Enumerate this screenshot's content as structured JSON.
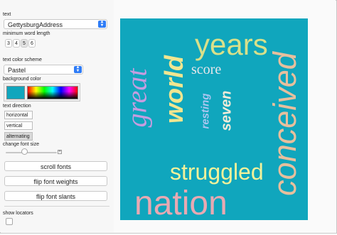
{
  "controls": {
    "text_label": "text",
    "text_value": "GettysburgAddress",
    "min_word_length_label": "minimum word length",
    "min_word_length_options": [
      "3",
      "4",
      "5",
      "6"
    ],
    "min_word_length_selected": "5",
    "text_color_scheme_label": "text color scheme",
    "text_color_scheme_value": "Pastel",
    "background_color_label": "background color",
    "background_color": "#10a6bd",
    "text_direction_label": "text direction",
    "text_direction_options": [
      "horizontal",
      "vertical",
      "alternating"
    ],
    "text_direction_selected": "alternating",
    "change_font_size_label": "change font size",
    "font_size_slider_value": 0.4,
    "scroll_fonts_label": "scroll fonts",
    "flip_font_weights_label": "flip font weights",
    "flip_font_slants_label": "flip font slants",
    "show_locators_label": "show locators",
    "show_locators_checked": false
  },
  "word_cloud": {
    "words": [
      {
        "text": "years",
        "color": "#d8e08a"
      },
      {
        "text": "score",
        "color": "#e6e6ea"
      },
      {
        "text": "seven",
        "color": "#f2ecd9"
      },
      {
        "text": "resting",
        "color": "#a9c6f0"
      },
      {
        "text": "great",
        "color": "#c59de0"
      },
      {
        "text": "world",
        "color": "#f1e690"
      },
      {
        "text": "conceived",
        "color": "#e7bf9d"
      },
      {
        "text": "struggled",
        "color": "#f3f19a"
      },
      {
        "text": "nation",
        "color": "#e9a9b2"
      }
    ]
  }
}
